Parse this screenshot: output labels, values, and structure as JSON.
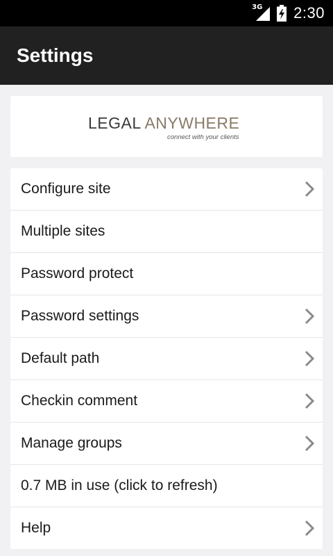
{
  "status_bar": {
    "network": "3G",
    "time": "2:30",
    "icons": [
      "signal-icon",
      "battery-charging-icon"
    ]
  },
  "app_bar": {
    "title": "Settings"
  },
  "logo": {
    "word1": "LEGAL",
    "word2": "ANYWHERE",
    "tagline": "connect with your clients"
  },
  "settings": {
    "items": [
      {
        "label": "Configure site",
        "has_chevron": true
      },
      {
        "label": "Multiple sites",
        "has_chevron": false
      },
      {
        "label": "Password protect",
        "has_chevron": false
      },
      {
        "label": "Password settings",
        "has_chevron": true
      },
      {
        "label": "Default path",
        "has_chevron": true
      },
      {
        "label": "Checkin comment",
        "has_chevron": true
      },
      {
        "label": "Manage groups",
        "has_chevron": true
      },
      {
        "label": "0.7 MB in use (click to refresh)",
        "has_chevron": false
      },
      {
        "label": "Help",
        "has_chevron": true
      }
    ]
  },
  "colors": {
    "status_bar": "#000000",
    "app_bar": "#212121",
    "background": "#f1f0f2",
    "card": "#ffffff",
    "chevron": "#8a8a8a"
  }
}
